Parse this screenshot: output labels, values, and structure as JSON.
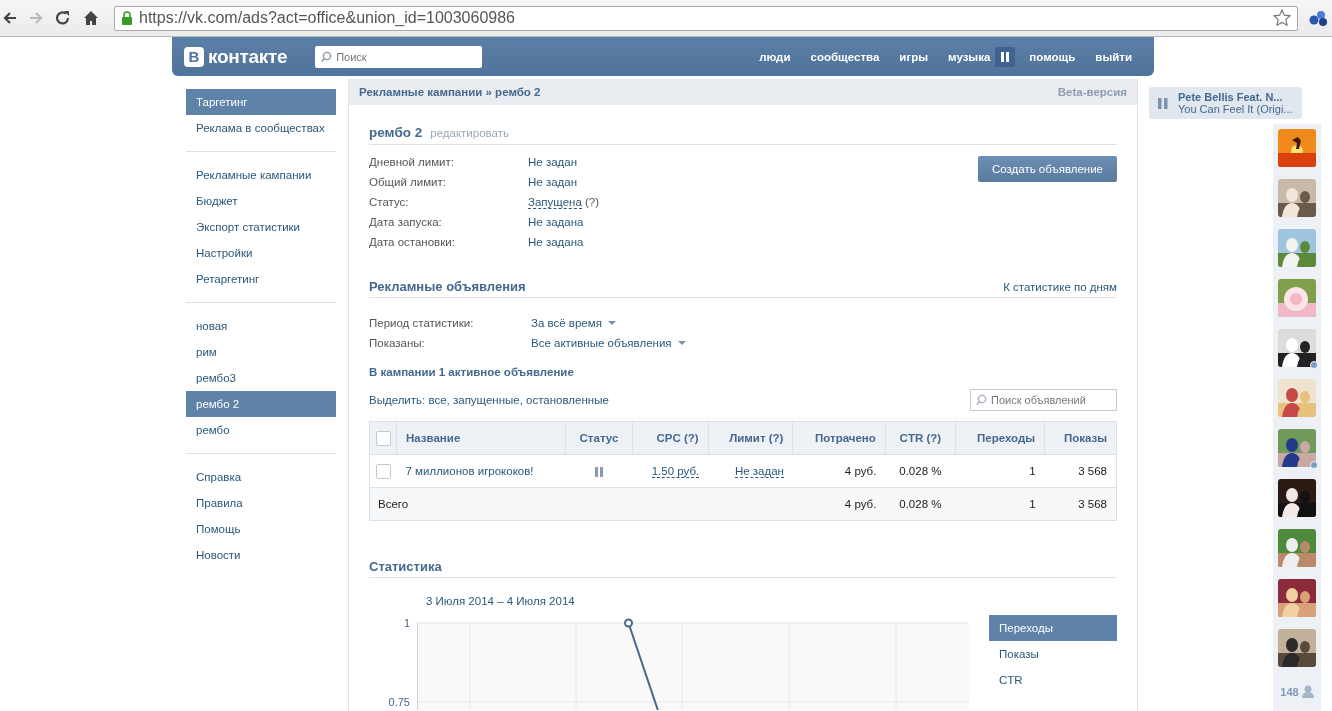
{
  "browser": {
    "url": "https://vk.com/ads?act=office&union_id=1003060986"
  },
  "header": {
    "logo_letter": "В",
    "logo_text": "контакте",
    "search_placeholder": "Поиск",
    "nav": [
      {
        "label": "люди"
      },
      {
        "label": "сообщества"
      },
      {
        "label": "игры"
      },
      {
        "label": "музыка"
      },
      {
        "label": "помощь"
      },
      {
        "label": "выйти"
      }
    ],
    "music_playing": true
  },
  "sidebar": {
    "groups": [
      [
        {
          "label": "Таргетинг",
          "selected": true
        },
        {
          "label": "Реклама в сообществах",
          "selected": false
        }
      ],
      [
        {
          "label": "Рекламные кампании",
          "selected": false
        },
        {
          "label": "Бюджет",
          "selected": false
        },
        {
          "label": "Экспорт статистики",
          "selected": false
        },
        {
          "label": "Настройки",
          "selected": false
        },
        {
          "label": "Ретаргетинг",
          "selected": false
        }
      ],
      [
        {
          "label": "новая",
          "selected": false
        },
        {
          "label": "рим",
          "selected": false
        },
        {
          "label": "рембо3",
          "selected": false
        },
        {
          "label": "рембо 2",
          "selected": true
        },
        {
          "label": "рембо",
          "selected": false
        }
      ],
      [
        {
          "label": "Справка",
          "selected": false
        },
        {
          "label": "Правила",
          "selected": false
        },
        {
          "label": "Помощь",
          "selected": false
        },
        {
          "label": "Новости",
          "selected": false
        }
      ]
    ]
  },
  "breadcrumb": "Рекламные кампании » рембо 2",
  "beta_label": "Beta-версия",
  "campaign": {
    "title": "рембо 2",
    "edit_link": "редактировать",
    "create_button": "Создать объявление",
    "info": [
      {
        "label": "Дневной лимит:",
        "value": "Не задан",
        "kind": "text"
      },
      {
        "label": "Общий лимит:",
        "value": "Не задан",
        "kind": "text"
      },
      {
        "label": "Статус:",
        "value": "Запущена",
        "hint": "(?)",
        "kind": "link"
      },
      {
        "label": "Дата запуска:",
        "value": "Не задана",
        "kind": "text"
      },
      {
        "label": "Дата остановки:",
        "value": "Не задана",
        "kind": "text"
      }
    ]
  },
  "ads": {
    "title": "Рекламные объявления",
    "stats_link": "К статистике по дням",
    "filters": [
      {
        "label": "Период статистики:",
        "value": "За всё время"
      },
      {
        "label": "Показаны:",
        "value": "Все активные объявления"
      }
    ],
    "summary": "В кампании 1 активное объявление",
    "select_line": "Выделить: все, запущенные, остановленные",
    "search_placeholder": "Поиск объявлений",
    "table": {
      "select_all_checked": false,
      "columns": [
        {
          "label": "Название"
        },
        {
          "label": "Статус"
        },
        {
          "label": "CPC (?)"
        },
        {
          "label": "Лимит (?)"
        },
        {
          "label": "Потрачено"
        },
        {
          "label": "CTR (?)"
        },
        {
          "label": "Переходы"
        },
        {
          "label": "Показы"
        }
      ],
      "rows": [
        {
          "checked": false,
          "name": "7 миллионов игрококов!",
          "running": true,
          "cpc": "1.50 руб.",
          "limit": "Не задан",
          "spent": "4 руб.",
          "ctr": "0.028 %",
          "clicks": "1",
          "impressions": "3 568"
        }
      ],
      "total": {
        "label": "Всего",
        "spent": "4 руб.",
        "ctr": "0.028 %",
        "clicks": "1",
        "impressions": "3 568"
      }
    }
  },
  "statistics": {
    "title": "Статистика",
    "date_range": "3 Июля 2014 – 4 Июля 2014",
    "chart_data": {
      "type": "line",
      "ylim": [
        0,
        1
      ],
      "yticks": [
        {
          "value": 0.75,
          "label": "0.75"
        },
        {
          "value": 1,
          "label": "1"
        }
      ],
      "series": [
        {
          "color": "#45688e",
          "marker": "circle",
          "values": [
            null,
            1,
            0,
            null,
            null
          ]
        }
      ]
    },
    "metrics": [
      {
        "label": "Переходы",
        "selected": true
      },
      {
        "label": "Показы",
        "selected": false
      },
      {
        "label": "CTR",
        "selected": false
      }
    ]
  },
  "player": {
    "title": "Pete Bellis Feat. N...",
    "track": "You Can Feel It (Origi...",
    "playing": true
  },
  "friends": {
    "items": [
      {
        "kind": "picture",
        "online": false
      },
      {
        "kind": "picture",
        "online": false
      },
      {
        "kind": "picture",
        "online": false
      },
      {
        "kind": "picture",
        "online": false
      },
      {
        "kind": "picture",
        "online": true
      },
      {
        "kind": "picture",
        "online": false
      },
      {
        "kind": "picture",
        "online": true
      },
      {
        "kind": "picture",
        "online": false
      },
      {
        "kind": "picture",
        "online": false
      },
      {
        "kind": "picture",
        "online": false
      },
      {
        "kind": "picture",
        "online": false
      }
    ],
    "count": "148"
  }
}
